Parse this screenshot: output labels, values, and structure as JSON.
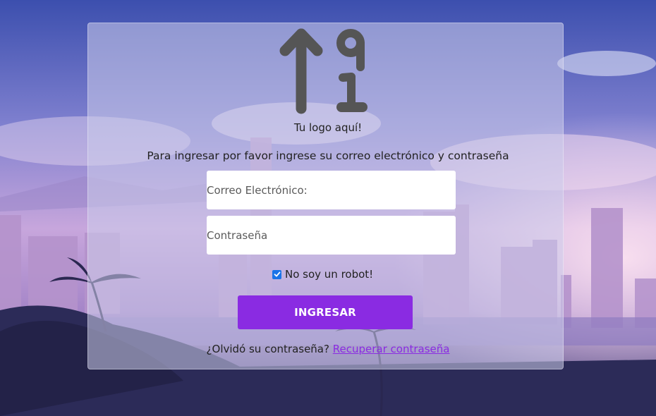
{
  "logo": {
    "icon": "sort-numeric-up-icon",
    "caption": "Tu logo aquí!"
  },
  "intro": "Para ingresar por favor ingrese su correo electrónico y contraseña",
  "email": {
    "placeholder": "Correo Electrónico:"
  },
  "password": {
    "placeholder": "Contraseña"
  },
  "captcha": {
    "label": "No soy un robot!",
    "checked": true
  },
  "submit": {
    "label": "INGRESAR"
  },
  "forgot": {
    "text": "¿Olvidó su contraseña?",
    "link": "Recuperar contraseña"
  },
  "colors": {
    "accent": "#8a2be2",
    "icon": "#555555"
  }
}
